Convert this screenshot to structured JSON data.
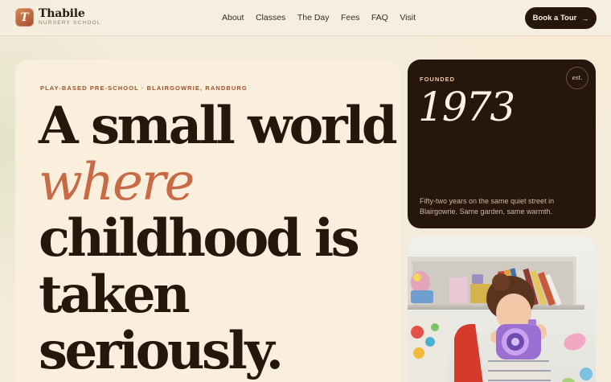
{
  "brand": {
    "initial": "T",
    "name": "Thabile",
    "subtitle": "NURSERY SCHOOL"
  },
  "nav": {
    "items": [
      "About",
      "Classes",
      "The Day",
      "Fees",
      "FAQ",
      "Visit"
    ]
  },
  "cta": {
    "label": "Book a  Tour",
    "icon": "arrow-right-icon"
  },
  "hero": {
    "eyebrow": "PLAY-BASED PRE-SCHOOL · BLAIRGOWRIE, RANDBURG",
    "headline": {
      "line1": "A small world",
      "line2": "where",
      "line3": "childhood is",
      "line4": "taken",
      "line5": "seriously."
    }
  },
  "founded": {
    "label": "FOUNDED",
    "year": "1973",
    "badge": "est.",
    "description": "Fifty-two years on the same quiet street in Blairgowrie. Same garden, same warmth."
  },
  "colors": {
    "accent": "#c86a45",
    "dark": "#27160c",
    "cream": "#f9efdc",
    "background": "#f4ecda"
  }
}
